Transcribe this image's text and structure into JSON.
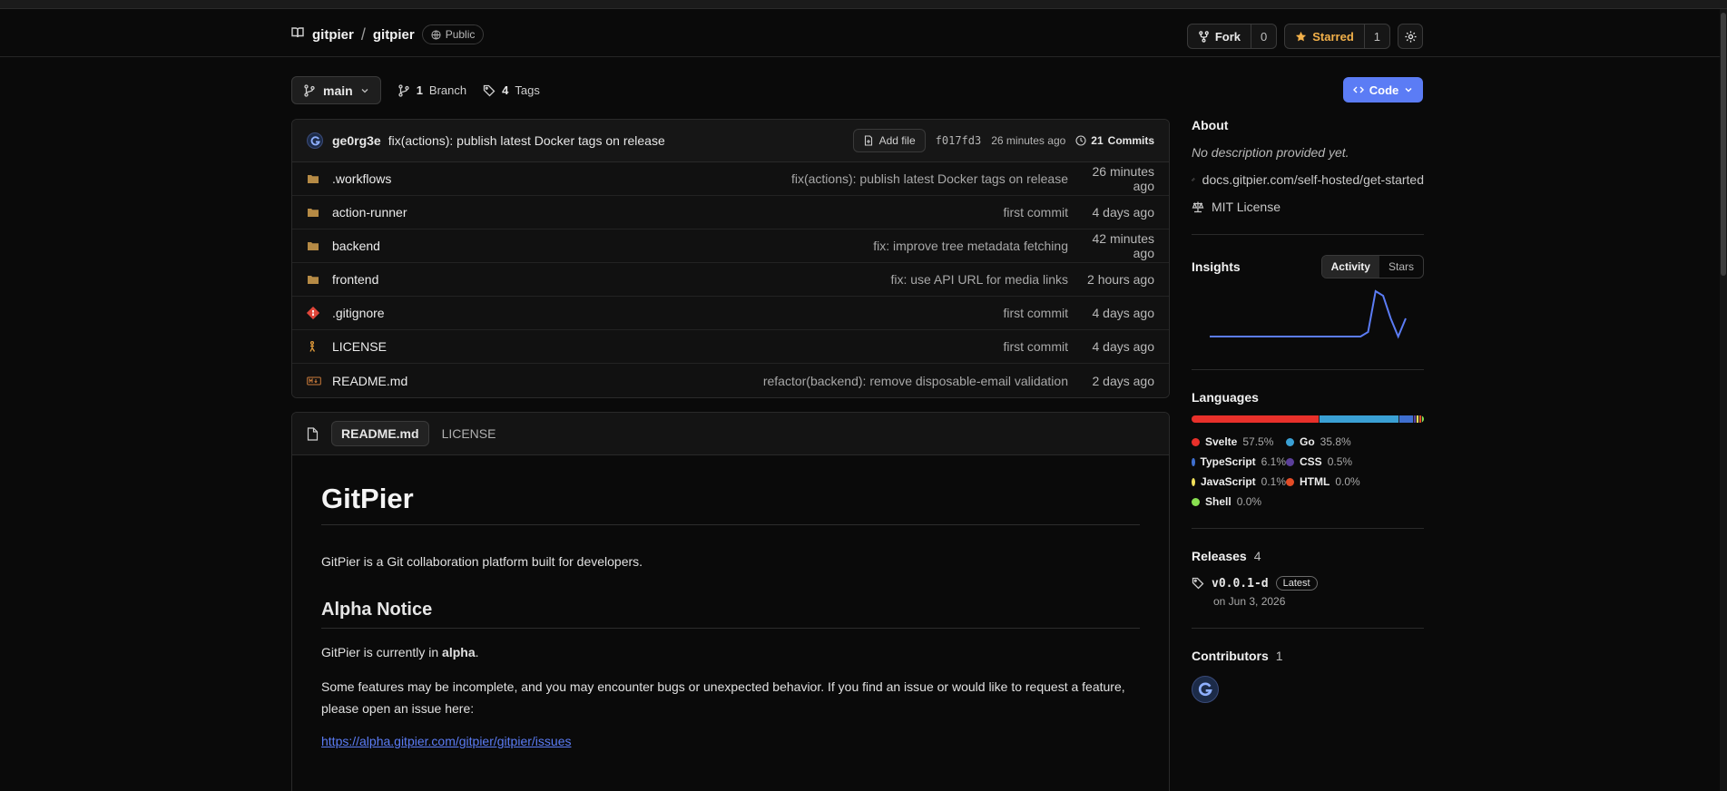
{
  "repo": {
    "owner": "gitpier",
    "name": "gitpier",
    "visibility": "Public"
  },
  "actions": {
    "fork_label": "Fork",
    "fork_count": "0",
    "star_label": "Starred",
    "star_count": "1",
    "settings_icon": "gear-icon"
  },
  "branchbar": {
    "branch": "main",
    "branches_count": "1",
    "branches_label": "Branch",
    "tags_count": "4",
    "tags_label": "Tags",
    "code_label": "Code"
  },
  "latest_commit": {
    "author": "ge0rg3e",
    "message": "fix(actions): publish latest Docker tags on release",
    "add_file_label": "Add file",
    "sha": "f017fd3",
    "time": "26 minutes ago",
    "commits_count": "21",
    "commits_label": "Commits"
  },
  "files": [
    {
      "name": ".workflows",
      "icon": "folder-icon",
      "message": "fix(actions): publish latest Docker tags on release",
      "time": "26 minutes ago"
    },
    {
      "name": "action-runner",
      "icon": "folder-icon",
      "message": "first commit",
      "time": "4 days ago"
    },
    {
      "name": "backend",
      "icon": "folder-icon",
      "message": "fix: improve tree metadata fetching",
      "time": "42 minutes ago"
    },
    {
      "name": "frontend",
      "icon": "folder-icon",
      "message": "fix: use API URL for media links",
      "time": "2 hours ago"
    },
    {
      "name": ".gitignore",
      "icon": "git-icon",
      "message": "first commit",
      "time": "4 days ago"
    },
    {
      "name": "LICENSE",
      "icon": "license-icon",
      "message": "first commit",
      "time": "4 days ago"
    },
    {
      "name": "README.md",
      "icon": "markdown-icon",
      "message": "refactor(backend): remove disposable-email validation",
      "time": "2 days ago"
    }
  ],
  "readme": {
    "tab_active": "README.md",
    "tab_other": "LICENSE",
    "title": "GitPier",
    "intro": "GitPier is a Git collaboration platform built for developers.",
    "alpha_heading": "Alpha Notice",
    "alpha_prefix": "GitPier is currently in ",
    "alpha_bold": "alpha",
    "alpha_suffix": ".",
    "issues_text": "Some features may be incomplete, and you may encounter bugs or unexpected behavior. If you find an issue or would like to request a feature, please open an issue here:",
    "issues_link": "https://alpha.gitpier.com/gitpier/gitpier/issues"
  },
  "about": {
    "heading": "About",
    "description": "No description provided yet.",
    "website": "docs.gitpier.com/self-hosted/get-started",
    "license": "MIT License"
  },
  "insights": {
    "heading": "Insights",
    "toggle_activity": "Activity",
    "toggle_stars": "Stars",
    "line_color": "#5b7cf5",
    "activity": [
      0,
      0,
      0,
      0,
      0,
      0,
      0,
      0,
      0,
      0,
      0,
      0,
      0,
      0,
      0,
      0,
      0,
      0,
      0,
      0,
      0,
      0.1,
      1,
      0.9,
      0.4,
      0,
      0.4
    ]
  },
  "languages": {
    "heading": "Languages",
    "items": [
      {
        "name": "Svelte",
        "pct": "57.5%",
        "value": 57.5,
        "color": "#e8302a"
      },
      {
        "name": "Go",
        "pct": "35.8%",
        "value": 35.8,
        "color": "#3aa0d4"
      },
      {
        "name": "TypeScript",
        "pct": "6.1%",
        "value": 6.1,
        "color": "#3f6fcf"
      },
      {
        "name": "CSS",
        "pct": "0.5%",
        "value": 0.5,
        "color": "#5b3f9a"
      },
      {
        "name": "JavaScript",
        "pct": "0.1%",
        "value": 0.1,
        "color": "#f1e05a"
      },
      {
        "name": "HTML",
        "pct": "0.0%",
        "value": 0.05,
        "color": "#e34c26"
      },
      {
        "name": "Shell",
        "pct": "0.0%",
        "value": 0.05,
        "color": "#89e051"
      }
    ]
  },
  "releases": {
    "heading": "Releases",
    "count": "4",
    "tag": "v0.0.1-d",
    "latest_label": "Latest",
    "date": "on Jun 3, 2026"
  },
  "contributors": {
    "heading": "Contributors",
    "count": "1"
  }
}
